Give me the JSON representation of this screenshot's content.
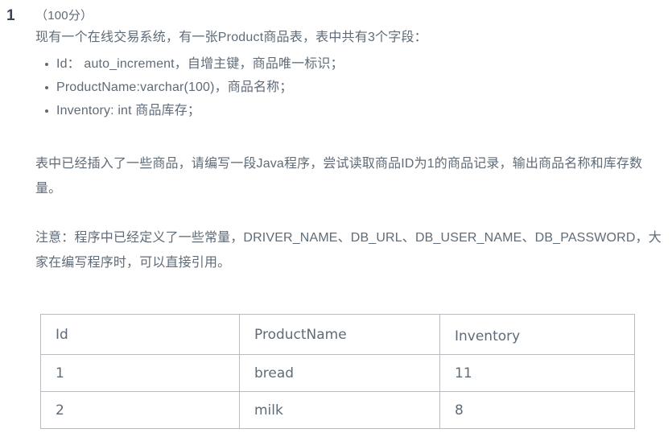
{
  "question": {
    "number": "1",
    "score_line": "（100分）",
    "intro": "现有一个在线交易系统，有一张Product商品表，表中共有3个字段：",
    "fields": [
      "Id： auto_increment，自增主键，商品唯一标识；",
      "ProductName:varchar(100)，商品名称；",
      "Inventory: int 商品库存；"
    ],
    "task_paragraph": "表中已经插入了一些商品，请编写一段Java程序，尝试读取商品ID为1的商品记录，输出商品名称和库存数量。",
    "note_paragraph": "注意：程序中已经定义了一些常量，DRIVER_NAME、DB_URL、DB_USER_NAME、DB_PASSWORD，大家在编写程序时，可以直接引用。"
  },
  "product_table": {
    "headers": [
      "Id",
      "ProductName",
      "Inventory"
    ],
    "rows": [
      [
        "1",
        "bread",
        "11"
      ],
      [
        "2",
        "milk",
        "8"
      ]
    ]
  },
  "colors": {
    "text": "#5f6b77",
    "number": "#3c4450",
    "table_border": "#b8bcc0",
    "page_background": "#ffffff"
  }
}
